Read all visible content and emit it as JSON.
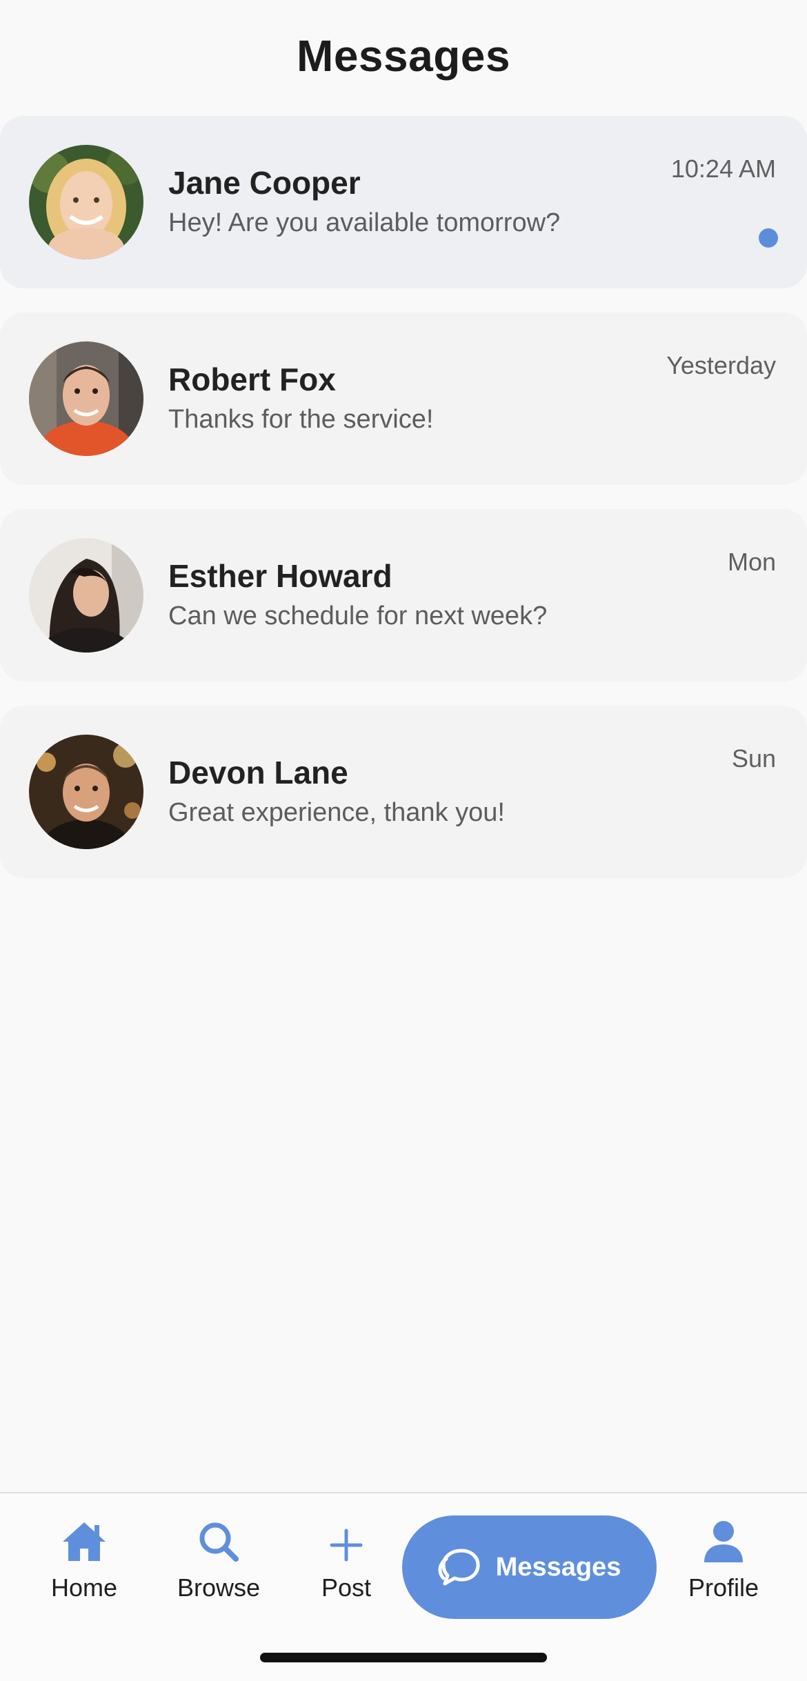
{
  "header": {
    "title": "Messages"
  },
  "conversations": [
    {
      "name": "Jane Cooper",
      "preview": "Hey! Are you available tomorrow?",
      "time": "10:24 AM",
      "unread": true
    },
    {
      "name": "Robert Fox",
      "preview": "Thanks for the service!",
      "time": "Yesterday",
      "unread": false
    },
    {
      "name": "Esther Howard",
      "preview": "Can we schedule for next week?",
      "time": "Mon",
      "unread": false
    },
    {
      "name": "Devon Lane",
      "preview": "Great experience, thank you!",
      "time": "Sun",
      "unread": false
    }
  ],
  "tabbar": {
    "home": {
      "label": "Home",
      "icon": "home-icon"
    },
    "browse": {
      "label": "Browse",
      "icon": "search-icon"
    },
    "post": {
      "label": "Post",
      "icon": "plus-icon"
    },
    "messages": {
      "label": "Messages",
      "icon": "chat-bubble-icon",
      "active": true
    },
    "profile": {
      "label": "Profile",
      "icon": "person-icon"
    }
  },
  "colors": {
    "accent": "#5f8fdc",
    "unread_dot": "#5b8ddb",
    "unread_card": "#edeff3",
    "card": "#f3f3f3",
    "background": "#f9f9f9"
  }
}
